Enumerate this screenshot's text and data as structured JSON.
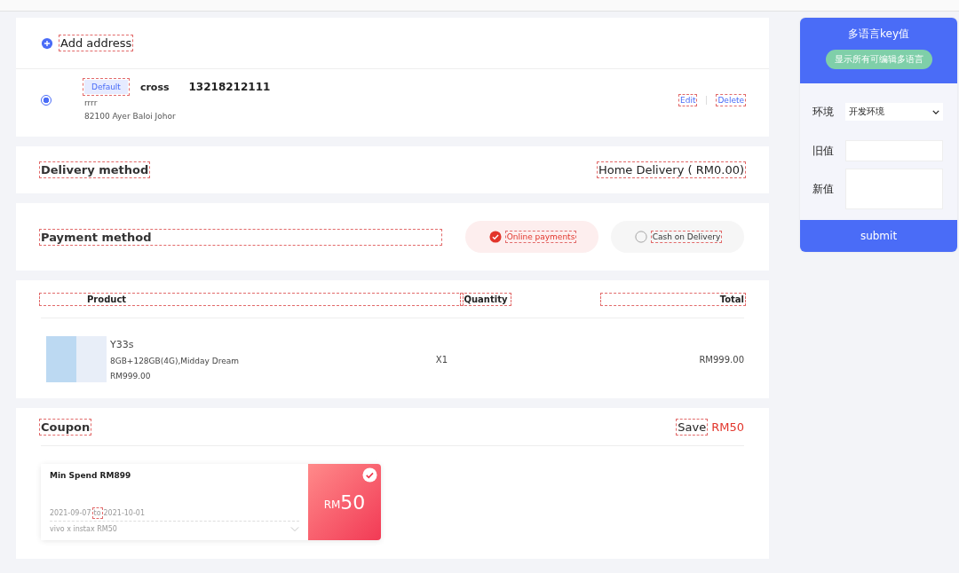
{
  "key_outlines": true,
  "address_section": {
    "add_label": "Add address",
    "addresses": [
      {
        "selected": true,
        "badge": "Default",
        "name": "cross",
        "phone": "13218212111",
        "line1": "rrrr",
        "line2": "82100 Ayer Baloi Johor",
        "edit": "Edit",
        "delete": "Delete"
      }
    ]
  },
  "delivery": {
    "label": "Delivery method",
    "value": "Home Delivery ( RM0.00)"
  },
  "payment": {
    "label": "Payment method",
    "options": [
      {
        "label": "Online payments",
        "selected": true
      },
      {
        "label": "Cash on Delivery",
        "selected": false
      }
    ]
  },
  "products": {
    "columns": [
      "Product",
      "Quantity",
      "Total"
    ],
    "rows": [
      {
        "name": "Y33s",
        "variant": "8GB+128GB(4G),Midday Dream",
        "price": "RM999.00",
        "quantity": "X1",
        "total": "RM999.00"
      }
    ]
  },
  "coupon": {
    "label": "Coupon",
    "save_label": "Save",
    "save_amount": "RM50",
    "coupons": [
      {
        "title": "Min Spend RM899",
        "start": "2021-09-07",
        "to": "to",
        "end": "2021-10-01",
        "note": "vivo x instax RM50",
        "currency": "RM",
        "amount": "50",
        "selected": true
      }
    ]
  },
  "i18n_panel": {
    "title": "多语言key值",
    "show_all_button": "显示所有可编辑多语言",
    "fields": [
      {
        "kind": "select",
        "label": "环境",
        "value": "开发环境"
      },
      {
        "kind": "input",
        "label": "旧值"
      },
      {
        "kind": "textarea",
        "label": "新值"
      }
    ],
    "submit": "submit"
  }
}
